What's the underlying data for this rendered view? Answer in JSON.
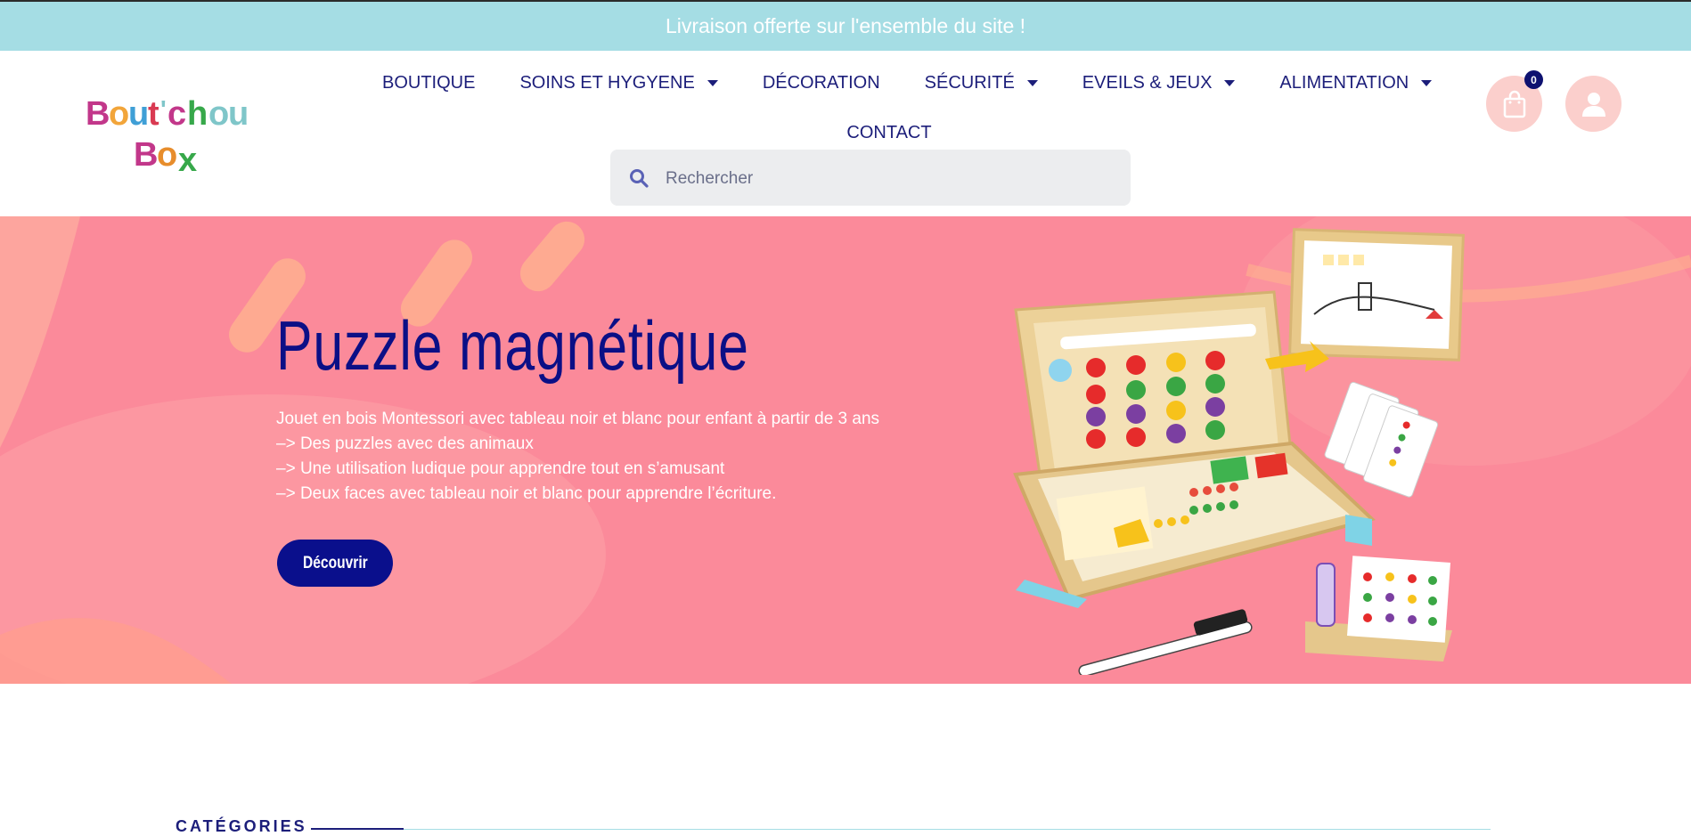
{
  "announcement": "Livraison offerte sur l'ensemble du site !",
  "logo": {
    "line1": "BOUT'CHOU",
    "line2": "BOX",
    "letter_colors": [
      "#c2378a",
      "#f2a53a",
      "#3f9fd6",
      "#d93a52",
      "#7fc6c9",
      "#c2378a",
      "#37a84a",
      "#d93a52",
      "#e78d2c"
    ]
  },
  "nav": {
    "row1": [
      {
        "label": "BOUTIQUE",
        "dropdown": false
      },
      {
        "label": "SOINS ET HYGYENE",
        "dropdown": true
      },
      {
        "label": "DÉCORATION",
        "dropdown": false
      },
      {
        "label": "SÉCURITÉ",
        "dropdown": true
      },
      {
        "label": "EVEILS & JEUX",
        "dropdown": true
      },
      {
        "label": "ALIMENTATION",
        "dropdown": true
      }
    ],
    "row2": [
      {
        "label": "CONTACT",
        "dropdown": false
      }
    ]
  },
  "search": {
    "placeholder": "Rechercher"
  },
  "cart": {
    "count": "0"
  },
  "hero": {
    "title": "Puzzle magnétique",
    "lines": [
      "Jouet en bois Montessori avec tableau noir et blanc pour enfant à partir de 3 ans",
      "–> Des puzzles avec des animaux",
      "–> Une utilisation ludique pour apprendre tout en s’amusant",
      "–> Deux faces avec tableau noir et blanc pour apprendre l’écriture."
    ],
    "cta": "Découvrir"
  },
  "section": {
    "title": "CATÉGORIES"
  },
  "colors": {
    "topbar": "#a5dde4",
    "nav_text": "#1c1e7a",
    "hero_bg": "#fb8a9a",
    "hero_title": "#0b0f86",
    "button": "#0a0f8c",
    "icon_circle": "#fbcfcc"
  },
  "icons": [
    "search-icon",
    "shopping-bag-icon",
    "user-icon",
    "chevron-down-icon"
  ]
}
